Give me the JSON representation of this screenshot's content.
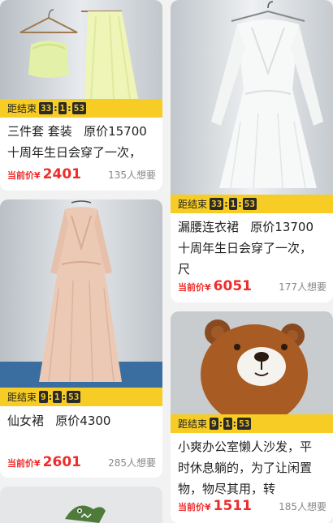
{
  "countdown_label": "距结束",
  "cards": [
    {
      "title": "三件套 套装   原价15700\n十周年生日会穿了一次，",
      "countdown": [
        "33",
        "1",
        "53"
      ],
      "price_label": "当前价¥",
      "price": "2401",
      "wants": "135人想要",
      "image": "dress-set-on-hanger"
    },
    {
      "title": "仙女裙   原价4300",
      "countdown": [
        "9",
        "1",
        "53"
      ],
      "price_label": "当前价¥",
      "price": "2601",
      "wants": "285人想要",
      "image": "sequin-gown"
    },
    {
      "title": "",
      "image": "dinosaur-toy"
    },
    {
      "title": "漏腰连衣裙   原价13700\n十周年生日会穿了一次，\n尺",
      "countdown": [
        "33",
        "1",
        "53"
      ],
      "price_label": "当前价¥",
      "price": "6051",
      "wants": "177人想要",
      "image": "white-ruffle-dress"
    },
    {
      "title": "小爽办公室懒人沙发，平\n时休息躺的，为了让闲置\n物，物尽其用，转",
      "countdown": [
        "9",
        "1",
        "53"
      ],
      "price_label": "当前价¥",
      "price": "1511",
      "wants": "185人想要",
      "image": "bear-bean-bag"
    }
  ],
  "colors": {
    "accent": "#f6cc25",
    "price": "#ee2c2c",
    "muted": "#888888"
  }
}
